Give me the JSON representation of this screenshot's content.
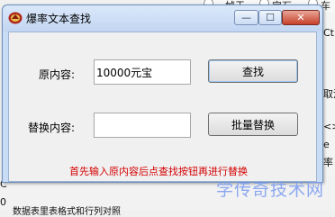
{
  "background": {
    "top_radios": [
      "帧于",
      "宝石",
      "车资"
    ],
    "right_texts": [
      "Ct:",
      "取消",
      "<>读",
      "e",
      "率"
    ],
    "bottom_texts": [
      "C",
      "0"
    ],
    "bottom_line": "数据表里表格式和行列对照"
  },
  "dialog": {
    "title": "爆率文本查找",
    "minimize_glyph": "—",
    "maximize_glyph": "☐",
    "close_glyph": "✕",
    "original_label": "原内容:",
    "original_value": "10000元宝",
    "find_button": "查找",
    "replace_label": "替换内容:",
    "replace_value": "",
    "batch_replace_button": "批量替换",
    "hint": "首先输入原内容后点查找按钮再进行替换"
  },
  "watermark": "学传奇技术网",
  "colors": {
    "hint": "#d40000",
    "titlebar": "#c9dcf5",
    "close": "#c6402a",
    "watermark": "#7f9ff0"
  }
}
